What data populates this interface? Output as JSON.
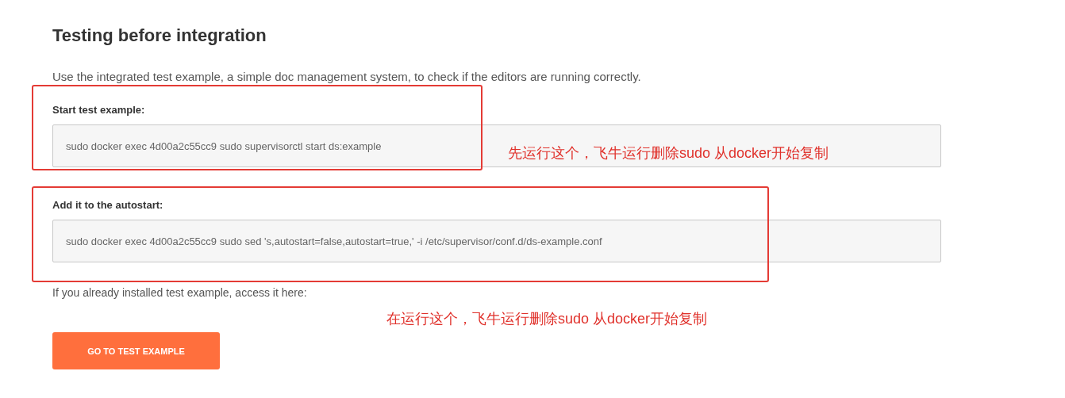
{
  "title": "Testing before integration",
  "description": "Use the integrated test example, a simple doc management system, to check if the editors are running correctly.",
  "sections": [
    {
      "label": "Start test example:",
      "command": "sudo docker exec 4d00a2c55cc9 sudo supervisorctl start ds:example",
      "highlighted": true
    },
    {
      "label": "Add it to the autostart:",
      "command": "sudo docker exec 4d00a2c55cc9 sudo sed 's,autostart=false,autostart=true,' -i /etc/supervisor/conf.d/ds-example.conf",
      "highlighted": true
    }
  ],
  "access_text": "If you already installed test example, access it here:",
  "annotations": [
    "先运行这个，飞牛运行删除sudo 从docker开始复制",
    "在运行这个，飞牛运行删除sudo 从docker开始复制"
  ],
  "button": "GO TO TEST EXAMPLE"
}
